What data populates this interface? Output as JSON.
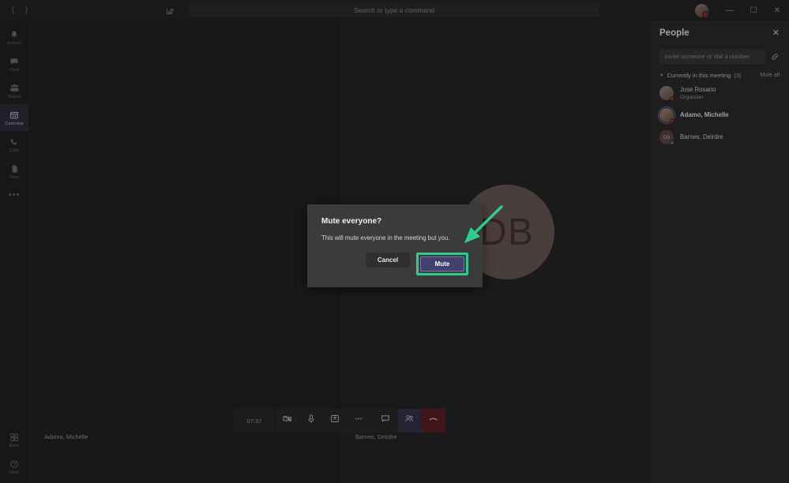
{
  "titlebar": {
    "back_icon": "chevron-left-icon",
    "forward_icon": "chevron-right-icon",
    "compose_icon": "compose-icon",
    "search_placeholder": "Search or type a command",
    "minimize_label": "—",
    "maximize_label": "☐",
    "close_label": "✕",
    "avatar_presence": "busy"
  },
  "rail": {
    "items": [
      {
        "label": "Activity",
        "icon": "bell-icon",
        "active": false
      },
      {
        "label": "Chat",
        "icon": "chat-icon",
        "active": false
      },
      {
        "label": "Teams",
        "icon": "teams-icon",
        "active": false
      },
      {
        "label": "Calendar",
        "icon": "calendar-icon",
        "active": true
      },
      {
        "label": "Calls",
        "icon": "phone-icon",
        "active": false
      },
      {
        "label": "Files",
        "icon": "files-icon",
        "active": false
      }
    ],
    "more_label": "•••",
    "bottom_items": [
      {
        "label": "Apps",
        "icon": "apps-icon"
      },
      {
        "label": "Help",
        "icon": "help-icon"
      }
    ]
  },
  "stage": {
    "left_tile_name": "Adamo, Michelle",
    "right_tile_name": "Barnes, Deirdre",
    "right_tile_initials": "DB"
  },
  "toolbar": {
    "timer": "07:37",
    "buttons": [
      {
        "name": "camera-off-button",
        "icon": "camera-off-icon"
      },
      {
        "name": "microphone-button",
        "icon": "microphone-icon"
      },
      {
        "name": "share-screen-button",
        "icon": "share-screen-icon"
      },
      {
        "name": "more-options-button",
        "icon": "ellipsis-icon"
      },
      {
        "name": "chat-button",
        "icon": "chat-bubble-icon"
      },
      {
        "name": "people-button",
        "icon": "people-icon"
      },
      {
        "name": "hangup-button",
        "icon": "hangup-icon"
      }
    ]
  },
  "people_panel": {
    "title": "People",
    "close_label": "✕",
    "invite_placeholder": "Invite someone or dial a number",
    "invite_icon": "share-link-icon",
    "section_label": "Currently in this meeting",
    "section_count": "(3)",
    "mute_all_label": "Mute all",
    "participants": [
      {
        "name": "Jose Rosario",
        "role": "Organizer",
        "presence": "busy",
        "initials": "",
        "bold": false
      },
      {
        "name": "Adamo, Michelle",
        "role": "",
        "presence": "busy",
        "initials": "",
        "bold": true
      },
      {
        "name": "Barnes, Deirdre",
        "role": "",
        "presence": "available",
        "initials": "DB",
        "bold": false
      }
    ]
  },
  "dialog": {
    "title": "Mute everyone?",
    "message": "This will mute everyone in the meeting but you.",
    "cancel_label": "Cancel",
    "confirm_label": "Mute"
  },
  "annotation": {
    "arrow_color": "#2ecc8f",
    "highlight_color": "#2ecc8f"
  }
}
